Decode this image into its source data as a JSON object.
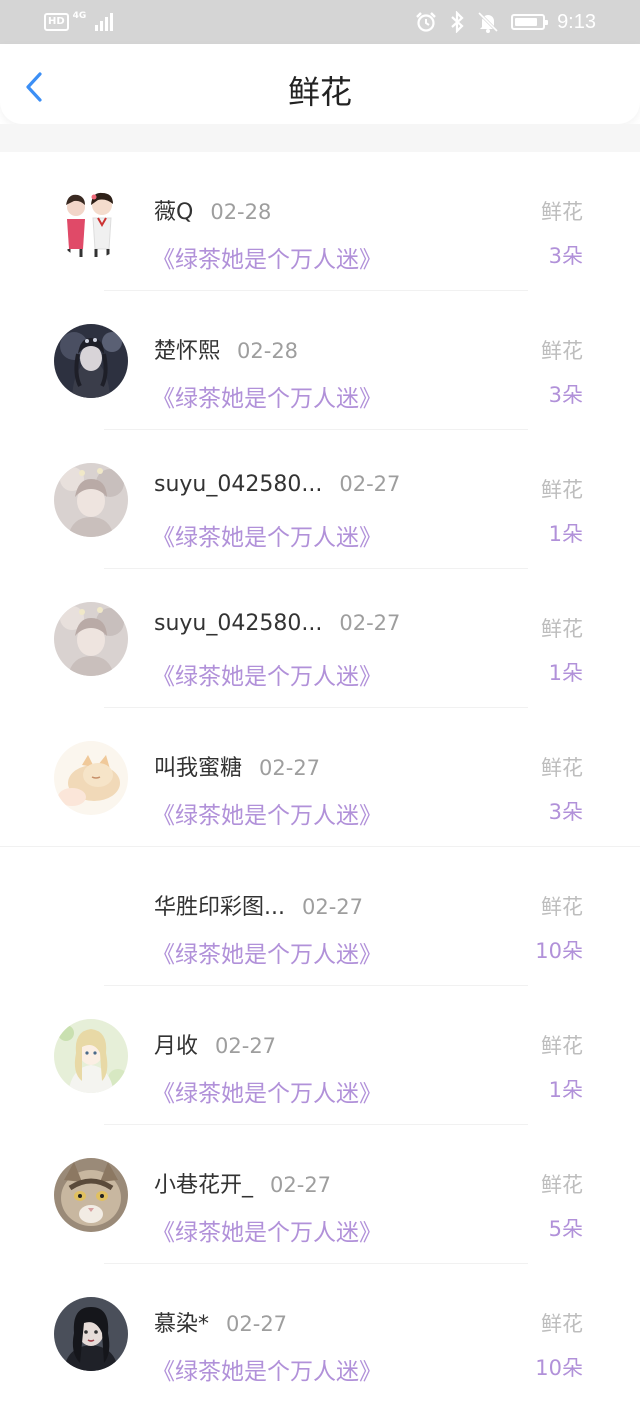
{
  "status_bar": {
    "hd": "HD",
    "network": "4G",
    "time": "9:13"
  },
  "header": {
    "title": "鲜花",
    "back_icon": "chevron-left-icon",
    "accent": "#3c8ff5"
  },
  "colors": {
    "book_accent": "#b191d9",
    "label_gray": "#bdbdbd",
    "date_gray": "#9e9e9e"
  },
  "items": [
    {
      "name": "薇Q",
      "date": "02-28",
      "book": "《绿茶她是个万人迷》",
      "label": "鲜花",
      "count": "3朵"
    },
    {
      "name": "楚怀熙",
      "date": "02-28",
      "book": "《绿茶她是个万人迷》",
      "label": "鲜花",
      "count": "3朵"
    },
    {
      "name": "suyu_042580...",
      "date": "02-27",
      "book": "《绿茶她是个万人迷》",
      "label": "鲜花",
      "count": "1朵"
    },
    {
      "name": "suyu_042580...",
      "date": "02-27",
      "book": "《绿茶她是个万人迷》",
      "label": "鲜花",
      "count": "1朵"
    },
    {
      "name": "叫我蜜糖",
      "date": "02-27",
      "book": "《绿茶她是个万人迷》",
      "label": "鲜花",
      "count": "3朵"
    },
    {
      "name": "华胜印彩图...",
      "date": "02-27",
      "book": "《绿茶她是个万人迷》",
      "label": "鲜花",
      "count": "10朵"
    },
    {
      "name": "月收",
      "date": "02-27",
      "book": "《绿茶她是个万人迷》",
      "label": "鲜花",
      "count": "1朵"
    },
    {
      "name": "小巷花开_",
      "date": "02-27",
      "book": "《绿茶她是个万人迷》",
      "label": "鲜花",
      "count": "5朵"
    },
    {
      "name": "慕染*",
      "date": "02-27",
      "book": "《绿茶她是个万人迷》",
      "label": "鲜花",
      "count": "10朵"
    }
  ]
}
